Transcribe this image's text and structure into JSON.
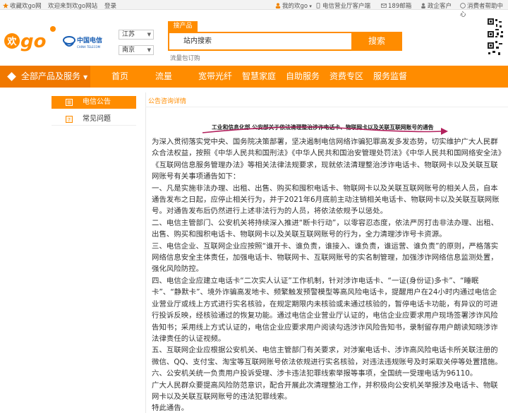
{
  "topbar": {
    "favorite": "收藏欢go网",
    "welcome": "欢迎来到欢go网站",
    "login": "登录",
    "my_hgo": "我的欢go",
    "business_hall": "电信营业厅客户端",
    "mobile_number": "189邮箱",
    "enterprise": "政企客户",
    "consumer_help": "消费者帮助中心"
  },
  "header": {
    "logo_text": "欢go",
    "partner": "中国电信",
    "city_1": "江苏",
    "city_2": "南京",
    "search_tab": "搜产品",
    "search_placeholder": "站内搜索",
    "search_button": "搜索",
    "hot": "流量包订购"
  },
  "nav": {
    "all_products": "全部产品及服务",
    "items": [
      "首页",
      "流量",
      "宽带光纤",
      "智慧家庭",
      "自助服务",
      "资费专区",
      "服务监督"
    ]
  },
  "sidebar": {
    "items": [
      "电信公告",
      "常见问题"
    ]
  },
  "breadcrumb": "公告咨询详情",
  "article": {
    "title": "工业和信息化部 公安部关于依法清理整治涉诈电话卡、物联网卡以及关联互联网账号的通告",
    "paragraphs": [
      "为深入贯彻落实党中央、国务院决策部署，坚决遏制电信网络诈骗犯罪高发多发态势，切实维护广大人民群众合法权益，按照《中华人民共和国刑法》《中华人民共和国治安管理处罚法》《中华人民共和国网络安全法》《互联网信息服务管理办法》等相关法律法规要求，现就依法清理整治涉诈电话卡、物联网卡以及关联互联网账号有关事项通告如下：",
      "一、凡是实施非法办理、出租、出售、购买和囤积电话卡、物联网卡以及关联互联网账号的相关人员，自本通告发布之日起，应停止相关行为，并于2021年6月底前主动注销相关电话卡、物联网卡以及关联互联网账号。对通告发布后仍然进行上述非法行为的人员，将依法依规予以惩处。",
      "二、电信主管部门、公安机关将持续深入推进“断卡行动”，以零容忍态度，依法严厉打击非法办理、出租、出售、购买和囤积电话卡、物联网卡以及关联互联网账号的行为，全力清理涉诈号卡资源。",
      "三、电信企业、互联网企业应按照“谁开卡、谁负责，谁接入、谁负责，谁运营、谁负责”的原则，严格落实网络信息安全主体责任，加强电话卡、物联网卡、互联网账号的实名制管理，加强涉诈网络信息监测处置，强化风险防控。",
      "四、电信企业应建立电话卡“二次实人认证”工作机制，针对涉诈电话卡、“一证(身份证)多卡”、“睡眠卡”、“静默卡”、境外诈骗高发地卡、频繁触发预警模型等高风险电话卡，提醒用户在24小时内通过电信企业营业厅或线上方式进行实名核验，在规定期限内未核验或未通过核验的，暂停电话卡功能，有异议的可进行投诉反映，经核验通过的恢复功能。通过电信企业营业厅认证的，电信企业应要求用户现场签署涉诈风险告知书；采用线上方式认证的，电信企业应要求用户阅读勾选涉诈风险告知书，录制留存用户朗读知晓涉诈法律责任的认证视频。",
      "五、互联网企业应根据公安机关、电信主管部门有关要求，对涉案电话卡、涉诈高风险电话卡所关联注册的微信、QQ、支付宝、淘宝等互联网账号依法依规进行实名核验，对违法违规账号及时采取关停等处置措施。",
      "六、公安机关统一负责用户投诉受理、涉卡违法犯罪线索举报等事项，全国统一受理电话为96110。",
      "广大人民群众要提高风险防范意识，配合开展此次清理整治工作，并积极向公安机关举报涉及电话卡、物联网卡以及关联互联网账号的违法犯罪线索。",
      "特此通告。"
    ]
  },
  "colors": {
    "accent": "#ff8c00",
    "accent_dark": "#f07800",
    "annotation": "#b2215d"
  },
  "icons": [
    "star-icon",
    "user-icon",
    "phone-icon",
    "mail-icon",
    "enterprise-icon",
    "help-icon",
    "notice-icon",
    "question-icon",
    "qr-code-icon"
  ]
}
